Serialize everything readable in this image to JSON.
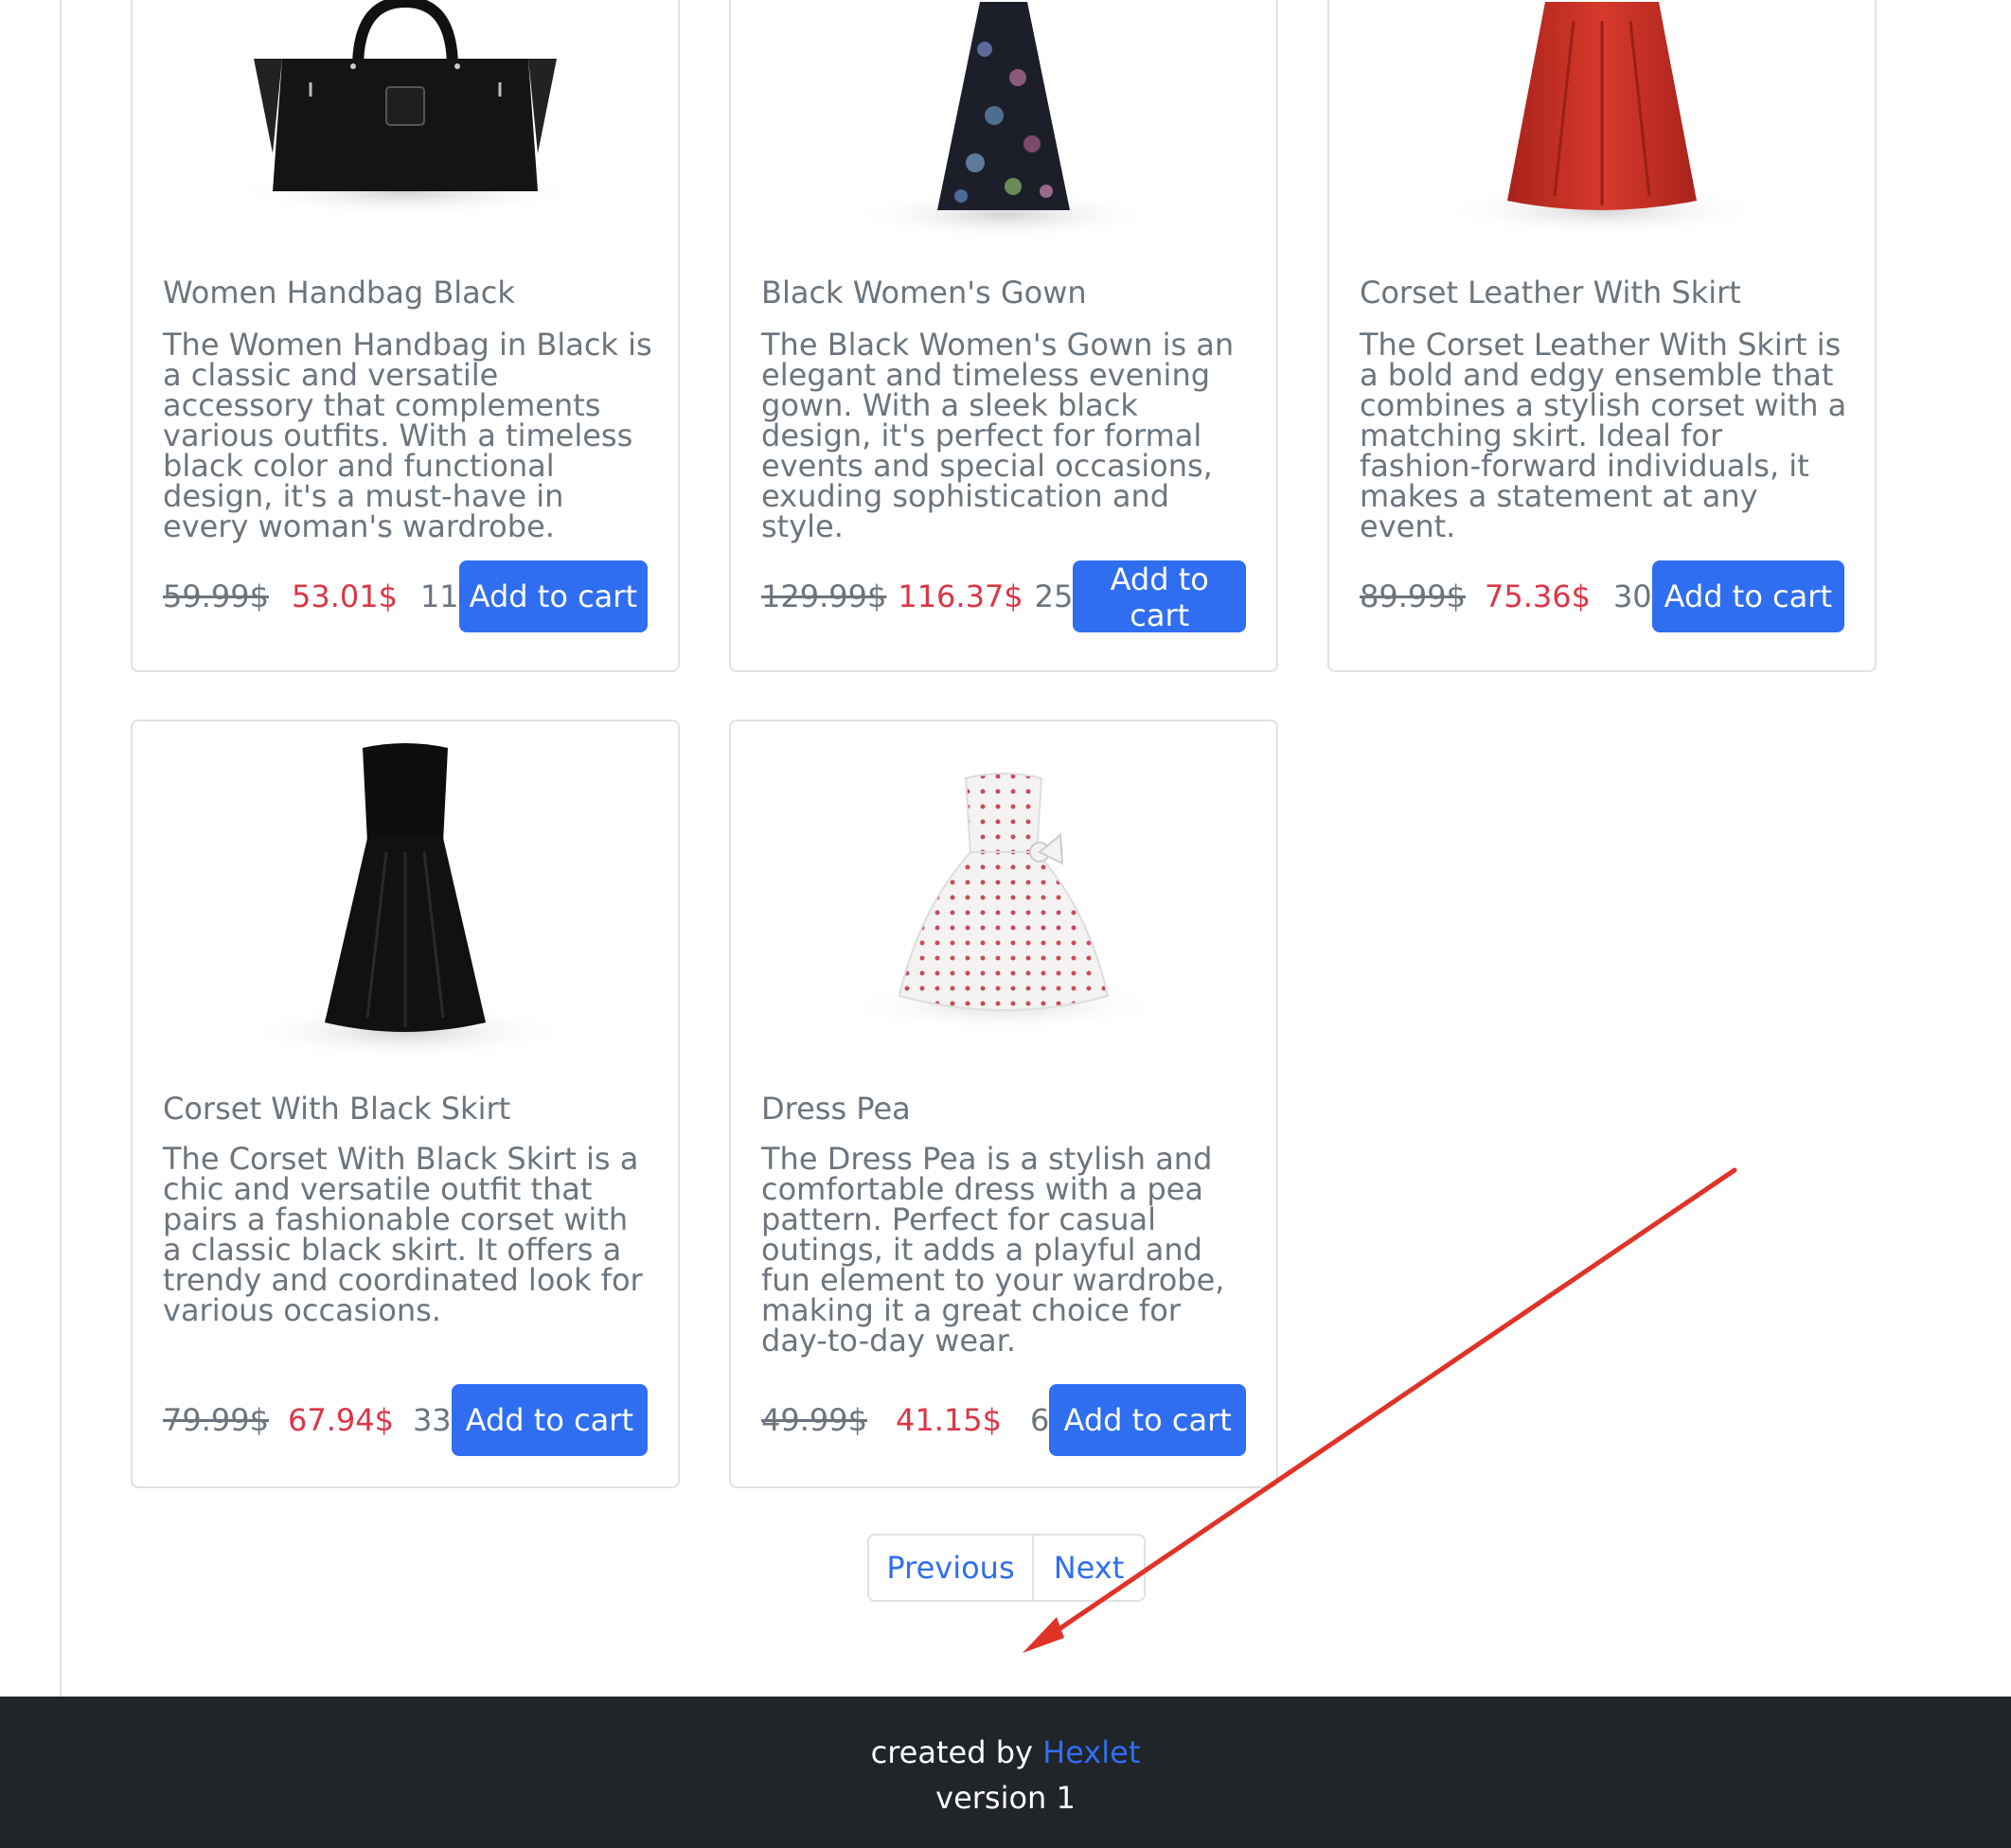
{
  "products": [
    {
      "name": "Women Handbag Black",
      "description": "The Women Handbag in Black is a classic and versatile accessory that complements various outfits. With a timeless black color and functional design, it's a must-have in every woman's wardrobe.",
      "old_price": "59.99$",
      "new_price": "53.01$",
      "stock": "11",
      "button_label": "Add to cart",
      "image_icon": "handbag-image"
    },
    {
      "name": "Black Women's Gown",
      "description": "The Black Women's Gown is an elegant and timeless evening gown. With a sleek black design, it's perfect for formal events and special occasions, exuding sophistication and style.",
      "old_price": "129.99$",
      "new_price": "116.37$",
      "stock": "25",
      "button_label": "Add to cart",
      "image_icon": "floral-gown-image"
    },
    {
      "name": "Corset Leather With Skirt",
      "description": "The Corset Leather With Skirt is a bold and edgy ensemble that combines a stylish corset with a matching skirt. Ideal for fashion-forward individuals, it makes a statement at any event.",
      "old_price": "89.99$",
      "new_price": "75.36$",
      "stock": "30",
      "button_label": "Add to cart",
      "image_icon": "red-skirt-image"
    },
    {
      "name": "Corset With Black Skirt",
      "description": "The Corset With Black Skirt is a chic and versatile outfit that pairs a fashionable corset with a classic black skirt. It offers a trendy and coordinated look for various occasions.",
      "old_price": "79.99$",
      "new_price": "67.94$",
      "stock": "33",
      "button_label": "Add to cart",
      "image_icon": "black-dress-image"
    },
    {
      "name": "Dress Pea",
      "description": "The Dress Pea is a stylish and comfortable dress with a pea pattern. Perfect for casual outings, it adds a playful and fun element to your wardrobe, making it a great choice for day-to-day wear.",
      "old_price": "49.99$",
      "new_price": "41.15$",
      "stock": "6",
      "button_label": "Add to cart",
      "image_icon": "polka-dot-dress-image"
    }
  ],
  "pagination": {
    "previous_label": "Previous",
    "next_label": "Next"
  },
  "footer": {
    "created_by_prefix": "created by",
    "created_by_link": "Hexlet",
    "version": "version 1"
  },
  "colors": {
    "primary": "#2f6ef1",
    "sale_price": "#dc3545",
    "footer_bg": "#212529",
    "annotation_arrow": "#e03327"
  }
}
